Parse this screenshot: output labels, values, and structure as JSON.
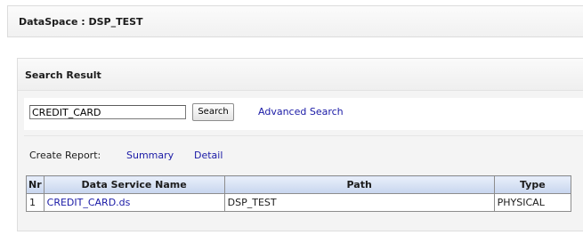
{
  "dataspace": {
    "title": "DataSpace : DSP_TEST"
  },
  "search_result": {
    "title": "Search Result",
    "search": {
      "value": "CREDIT_CARD",
      "button_label": "Search",
      "advanced_link": "Advanced Search"
    },
    "report": {
      "label": "Create Report:",
      "summary_link": "Summary",
      "detail_link": "Detail"
    },
    "table": {
      "columns": [
        "Nr",
        "Data Service Name",
        "Path",
        "Type"
      ],
      "rows": [
        {
          "nr": "1",
          "name": "CREDIT_CARD.ds",
          "path": "DSP_TEST",
          "type": "PHYSICAL"
        }
      ]
    }
  },
  "colors": {
    "link": "#1a1aa6",
    "header_grad_top": "#e9effa",
    "header_grad_bottom": "#c7d5ee",
    "border": "#8d8d8d"
  }
}
